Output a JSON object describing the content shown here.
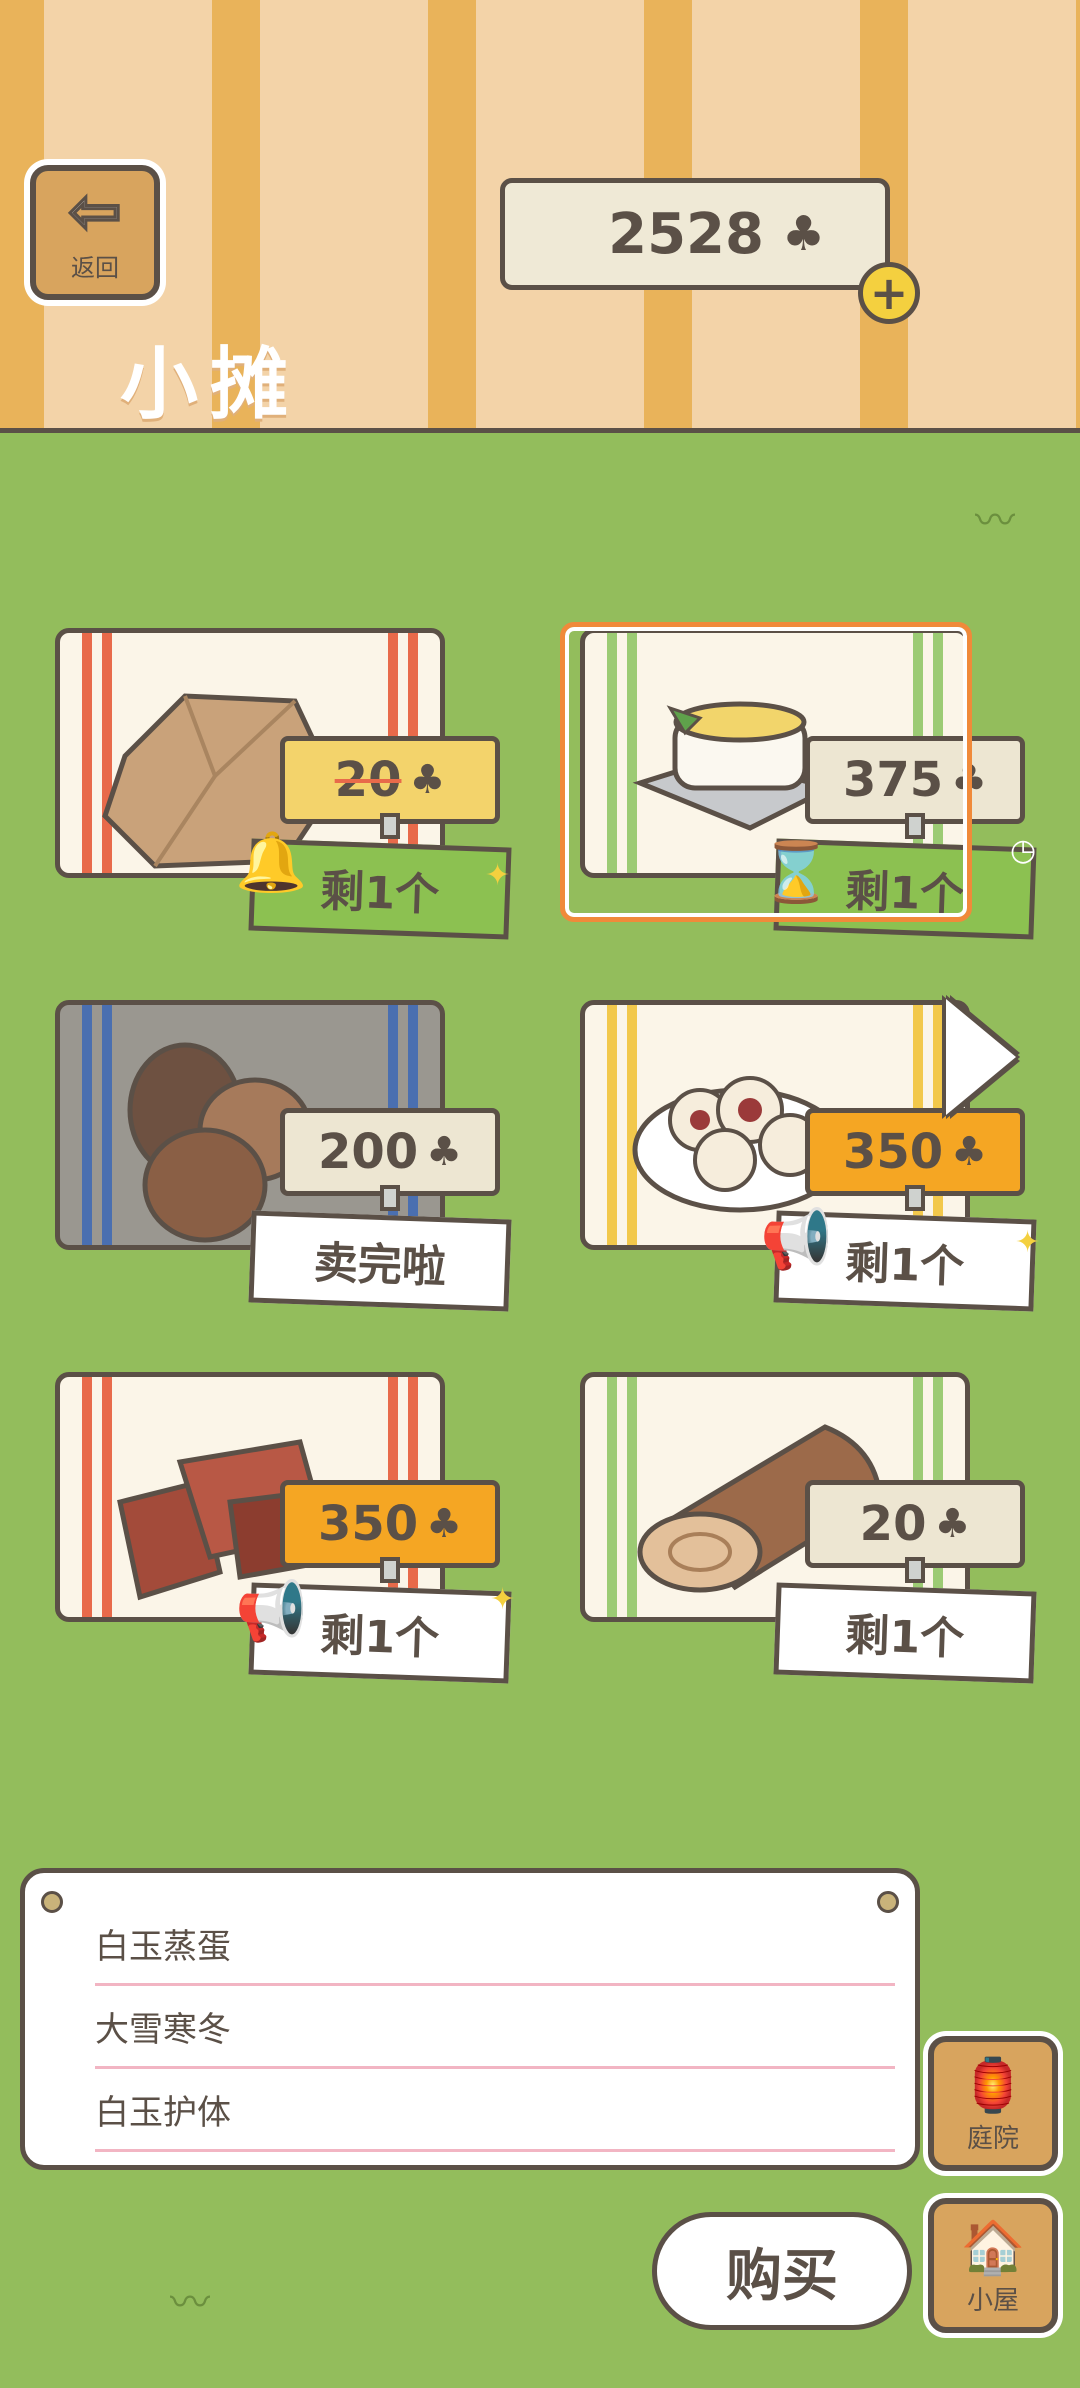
{
  "header": {
    "back_label": "返回",
    "back_arrow": "⇦",
    "title": "小摊",
    "coins": "2528",
    "coin_icon": "♣",
    "plus_icon": "+"
  },
  "items": [
    {
      "price": "20",
      "stock": "剩1个",
      "discount": true,
      "icon": "bell-icon"
    },
    {
      "price": "375",
      "stock": "剩1个",
      "icon": "hourglass-icon"
    },
    {
      "price": "200",
      "stock": "卖完啦"
    },
    {
      "price": "350",
      "stock": "剩1个",
      "icon": "megaphone-icon"
    },
    {
      "price": "350",
      "stock": "剩1个",
      "icon": "megaphone-icon"
    },
    {
      "price": "20",
      "stock": "剩1个"
    }
  ],
  "memo": {
    "lines": [
      "白玉蒸蛋",
      "大雪寒冬",
      "白玉护体"
    ]
  },
  "nav": {
    "yard_label": "庭院",
    "house_label": "小屋",
    "buy_label": "购买"
  },
  "colors": {
    "grass": "#93bd5c",
    "outline": "#5b5047",
    "selected": "#f08a3a"
  }
}
